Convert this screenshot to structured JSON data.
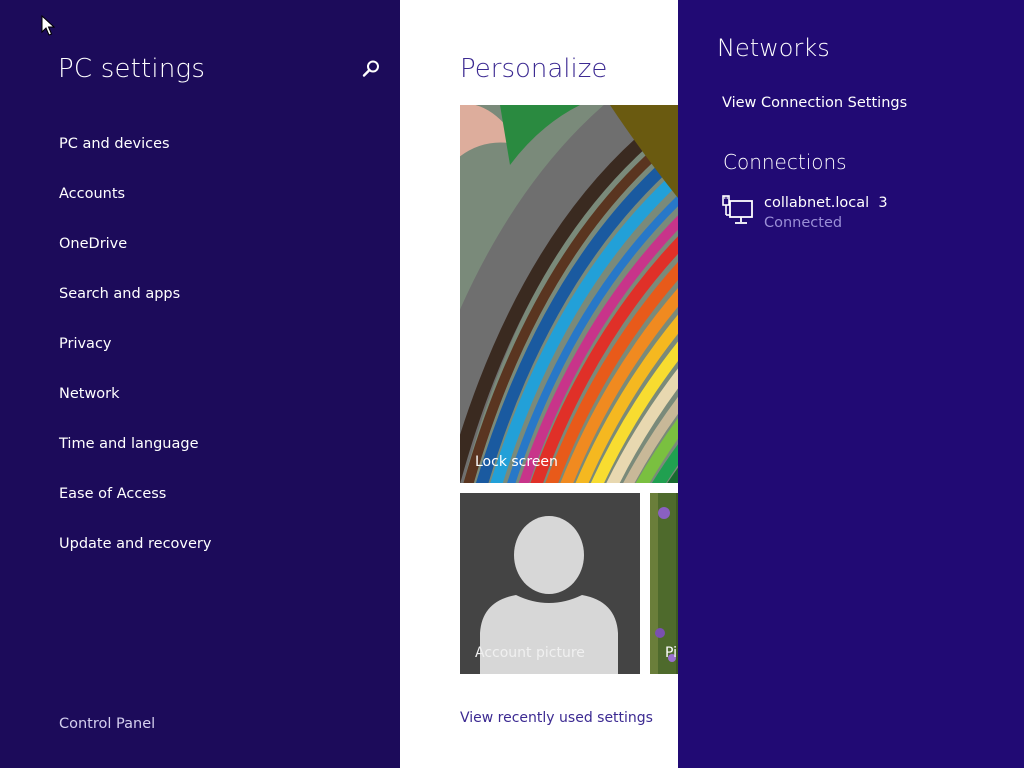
{
  "nav": {
    "title": "PC settings",
    "items": [
      {
        "label": "PC and devices"
      },
      {
        "label": "Accounts"
      },
      {
        "label": "OneDrive"
      },
      {
        "label": "Search and apps"
      },
      {
        "label": "Privacy"
      },
      {
        "label": "Network"
      },
      {
        "label": "Time and language"
      },
      {
        "label": "Ease of Access"
      },
      {
        "label": "Update and recovery"
      }
    ],
    "footer_link": "Control Panel",
    "search_icon": "magnifier-icon"
  },
  "content": {
    "title": "Personalize",
    "tiles": {
      "lock_screen": "Lock screen",
      "account_picture": "Account picture",
      "picture_password": "Pi"
    },
    "recent_link": "View recently used settings"
  },
  "flyout": {
    "title": "Networks",
    "view_settings": "View Connection Settings",
    "connections_heading": "Connections",
    "connection": {
      "name": "collabnet.local  3",
      "status": "Connected",
      "icon": "wired-network-icon"
    }
  },
  "colors": {
    "nav_bg": "#1c0b5a",
    "flyout_bg": "#210a74",
    "accent": "#3c2a92",
    "status_text": "#9a8fd6"
  }
}
